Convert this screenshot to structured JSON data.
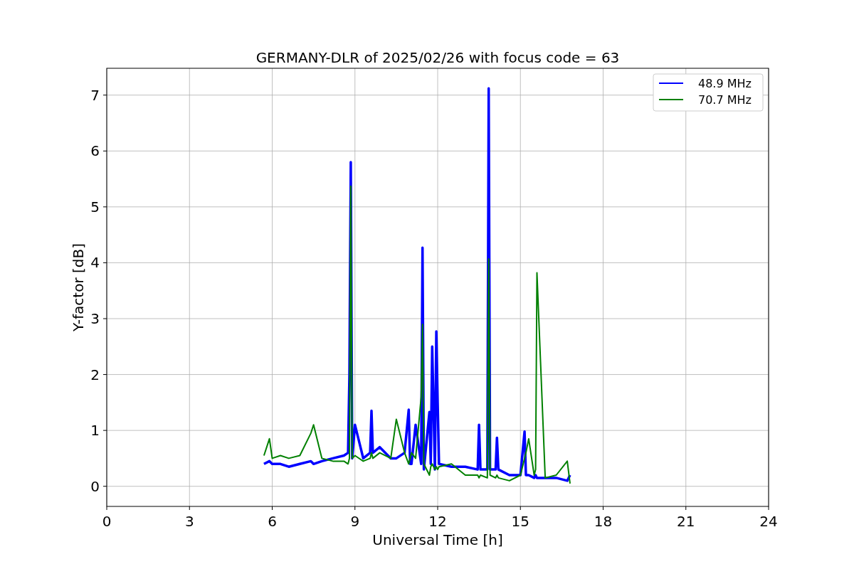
{
  "chart_data": {
    "type": "line",
    "title": "GERMANY-DLR of 2025/02/26 with focus code = 63",
    "xlabel": "Universal Time [h]",
    "ylabel": "Y-factor [dB]",
    "xlim": [
      0,
      24
    ],
    "ylim": [
      -0.36,
      7.48
    ],
    "grid": true,
    "legend": true,
    "xticks": [
      0,
      3,
      6,
      9,
      12,
      15,
      18,
      21,
      24
    ],
    "yticks": [
      0,
      1,
      2,
      3,
      4,
      5,
      6,
      7
    ],
    "x": [
      5.7,
      5.9,
      6.0,
      6.3,
      6.6,
      7.0,
      7.4,
      7.5,
      7.8,
      8.2,
      8.6,
      8.75,
      8.8,
      8.85,
      8.9,
      9.0,
      9.3,
      9.55,
      9.6,
      9.65,
      9.9,
      10.3,
      10.5,
      10.8,
      10.95,
      11.0,
      11.05,
      11.2,
      11.4,
      11.45,
      11.5,
      11.7,
      11.75,
      11.8,
      11.9,
      11.95,
      12.0,
      12.05,
      12.5,
      13.0,
      13.45,
      13.5,
      13.55,
      13.8,
      13.85,
      13.9,
      14.1,
      14.15,
      14.2,
      14.6,
      15.0,
      15.15,
      15.2,
      15.3,
      15.5,
      15.55,
      15.6,
      15.9,
      16.3,
      16.7,
      16.8
    ],
    "series": [
      {
        "name": "48.9 MHz",
        "color": "#0000ff",
        "values": [
          0.4,
          0.45,
          0.4,
          0.4,
          0.35,
          0.4,
          0.45,
          0.4,
          0.45,
          0.5,
          0.55,
          0.6,
          2.0,
          5.8,
          0.5,
          1.1,
          0.5,
          0.6,
          1.35,
          0.6,
          0.7,
          0.5,
          0.5,
          0.6,
          1.37,
          0.4,
          0.4,
          1.1,
          0.4,
          4.27,
          0.3,
          1.33,
          0.4,
          2.5,
          0.3,
          2.77,
          1.5,
          0.4,
          0.35,
          0.35,
          0.3,
          1.1,
          0.3,
          0.3,
          7.12,
          0.3,
          0.3,
          0.87,
          0.3,
          0.2,
          0.2,
          0.98,
          0.2,
          0.2,
          0.15,
          0.2,
          0.15,
          0.15,
          0.15,
          0.1,
          0.2
        ]
      },
      {
        "name": "70.7 MHz",
        "color": "#008000",
        "values": [
          0.55,
          0.85,
          0.5,
          0.55,
          0.5,
          0.55,
          0.95,
          1.1,
          0.5,
          0.45,
          0.45,
          0.4,
          0.5,
          5.37,
          0.5,
          0.55,
          0.45,
          0.5,
          0.6,
          0.5,
          0.6,
          0.5,
          1.2,
          0.6,
          0.4,
          0.5,
          0.6,
          0.5,
          1.6,
          2.9,
          0.4,
          0.2,
          0.35,
          0.4,
          0.3,
          0.35,
          0.3,
          0.35,
          0.4,
          0.2,
          0.2,
          0.15,
          0.2,
          0.15,
          4.07,
          0.2,
          0.15,
          0.2,
          0.15,
          0.1,
          0.2,
          0.5,
          0.6,
          0.85,
          0.2,
          0.3,
          3.82,
          0.15,
          0.2,
          0.45,
          0.05
        ]
      }
    ]
  }
}
